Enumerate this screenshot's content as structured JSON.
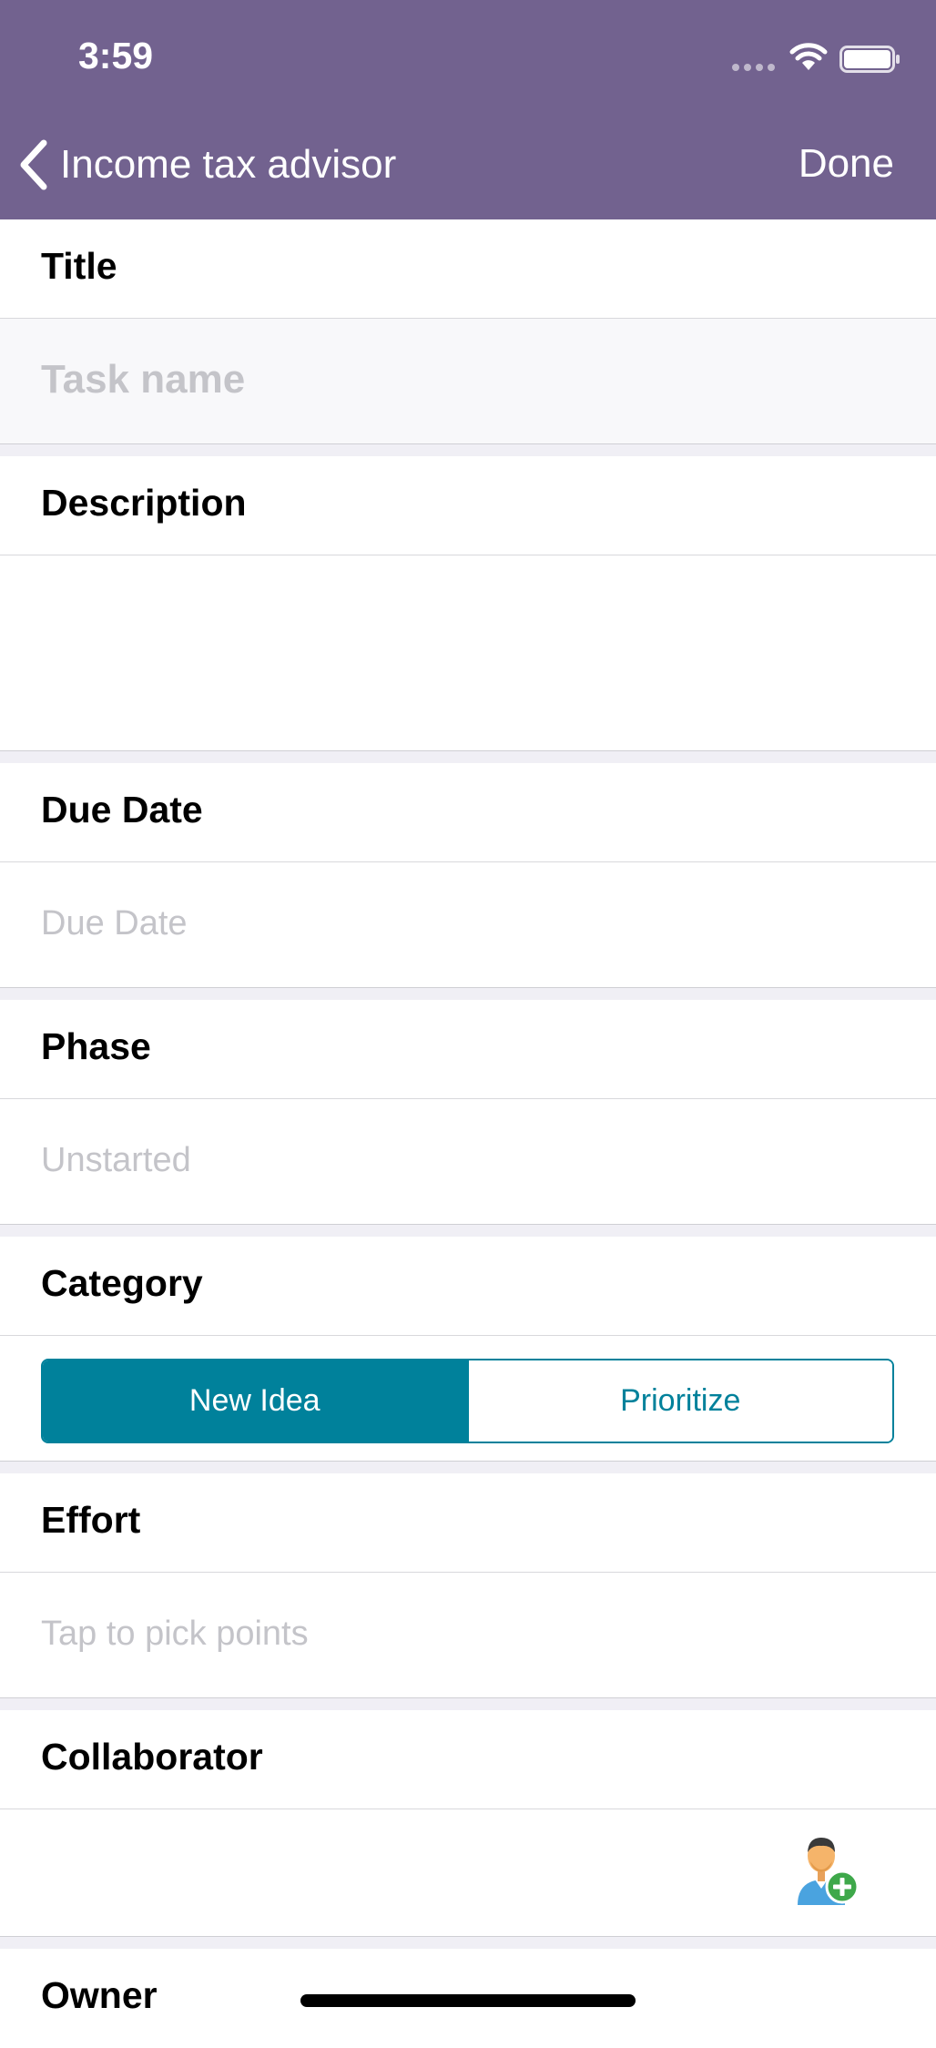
{
  "status_bar": {
    "time": "3:59"
  },
  "nav": {
    "back_label": "Income tax advisor",
    "done_label": "Done"
  },
  "sections": {
    "title": {
      "label": "Title",
      "placeholder": "Task name"
    },
    "description": {
      "label": "Description"
    },
    "due_date": {
      "label": "Due Date",
      "placeholder": "Due Date"
    },
    "phase": {
      "label": "Phase",
      "placeholder": "Unstarted"
    },
    "category": {
      "label": "Category",
      "options": [
        "New Idea",
        "Prioritize"
      ],
      "selected": "New Idea"
    },
    "effort": {
      "label": "Effort",
      "placeholder": "Tap to pick points"
    },
    "collaborator": {
      "label": "Collaborator"
    },
    "owner": {
      "label": "Owner"
    }
  },
  "colors": {
    "nav_bg": "#72628f",
    "accent": "#00819b",
    "placeholder": "#c4c4c9",
    "add_badge": "#3ea84a"
  },
  "icons": {
    "back": "chevron-left-icon",
    "wifi": "wifi-icon",
    "battery": "battery-icon",
    "add_collaborator": "add-user-icon"
  }
}
